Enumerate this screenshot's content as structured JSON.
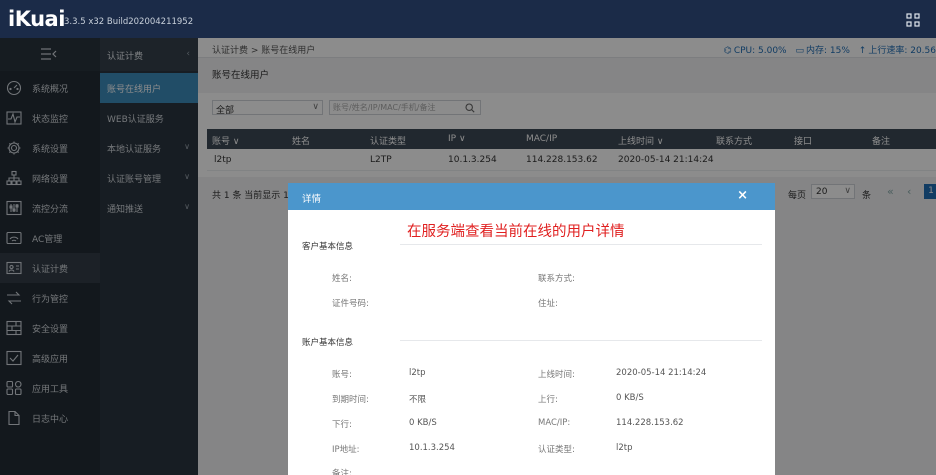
{
  "header": {
    "logo": "iKuai",
    "version": "3.3.5 x32 Build202004211952"
  },
  "sidebar": {
    "items": [
      {
        "label": "系统概况",
        "icon": "dashboard-icon"
      },
      {
        "label": "状态监控",
        "icon": "monitor-icon"
      },
      {
        "label": "系统设置",
        "icon": "gear-icon"
      },
      {
        "label": "网络设置",
        "icon": "network-icon"
      },
      {
        "label": "流控分流",
        "icon": "sliders-icon"
      },
      {
        "label": "AC管理",
        "icon": "ac-icon"
      },
      {
        "label": "认证计费",
        "icon": "auth-icon"
      },
      {
        "label": "行为管控",
        "icon": "behavior-icon"
      },
      {
        "label": "安全设置",
        "icon": "security-icon"
      },
      {
        "label": "高级应用",
        "icon": "advanced-icon"
      },
      {
        "label": "应用工具",
        "icon": "tools-icon"
      },
      {
        "label": "日志中心",
        "icon": "log-icon"
      }
    ]
  },
  "subnav": {
    "title": "认证计费",
    "collapse": "‹",
    "items": [
      {
        "label": "账号在线用户",
        "chev": ""
      },
      {
        "label": "WEB认证服务",
        "chev": ""
      },
      {
        "label": "本地认证服务",
        "chev": "∨"
      },
      {
        "label": "认证账号管理",
        "chev": "∨"
      },
      {
        "label": "通知推送",
        "chev": "∨"
      }
    ]
  },
  "breadcrumb": "认证计费 > 账号在线用户",
  "stats": {
    "cpu": "CPU: 5.00%",
    "mem": "内存: 15%",
    "upload": "上行速率: 20.56"
  },
  "page_title": "账号在线用户",
  "filter": {
    "select_value": "全部",
    "search_placeholder": "账号/姓名/IP/MAC/手机/备注"
  },
  "table": {
    "columns": [
      "账号 ∨",
      "姓名",
      "认证类型",
      "IP ∨",
      "MAC/IP",
      "上线时间 ∨",
      "联系方式",
      "接口",
      "备注"
    ],
    "rows": [
      [
        "l2tp",
        "",
        "L2TP",
        "10.1.3.254",
        "114.228.153.62",
        "2020-05-14 21:14:24",
        "",
        "",
        ""
      ]
    ]
  },
  "pagination": {
    "summary": "共 1 条 当前显示 1",
    "per_page_label": "每页",
    "per_page_value": "20",
    "unit": "条",
    "first": "«",
    "prev": "‹",
    "current": "1"
  },
  "modal": {
    "title": "详情",
    "close": "×",
    "annotation": "在服务端查看当前在线的用户详情",
    "section1": {
      "title": "客户基本信息",
      "name_label": "姓名:",
      "contact_label": "联系方式:",
      "id_label": "证件号码:",
      "address_label": "住址:"
    },
    "section2": {
      "title": "账户基本信息",
      "account_label": "账号:",
      "account_value": "l2tp",
      "online_label": "上线时间:",
      "online_value": "2020-05-14 21:14:24",
      "expire_label": "到期时间:",
      "expire_value": "不限",
      "up_label": "上行:",
      "up_value": "0 KB/S",
      "down_label": "下行:",
      "down_value": "0 KB/S",
      "mac_label": "MAC/IP:",
      "mac_value": "114.228.153.62",
      "ip_label": "IP地址:",
      "ip_value": "10.1.3.254",
      "auth_label": "认证类型:",
      "auth_value": "l2tp",
      "remark_label": "备注:"
    }
  }
}
